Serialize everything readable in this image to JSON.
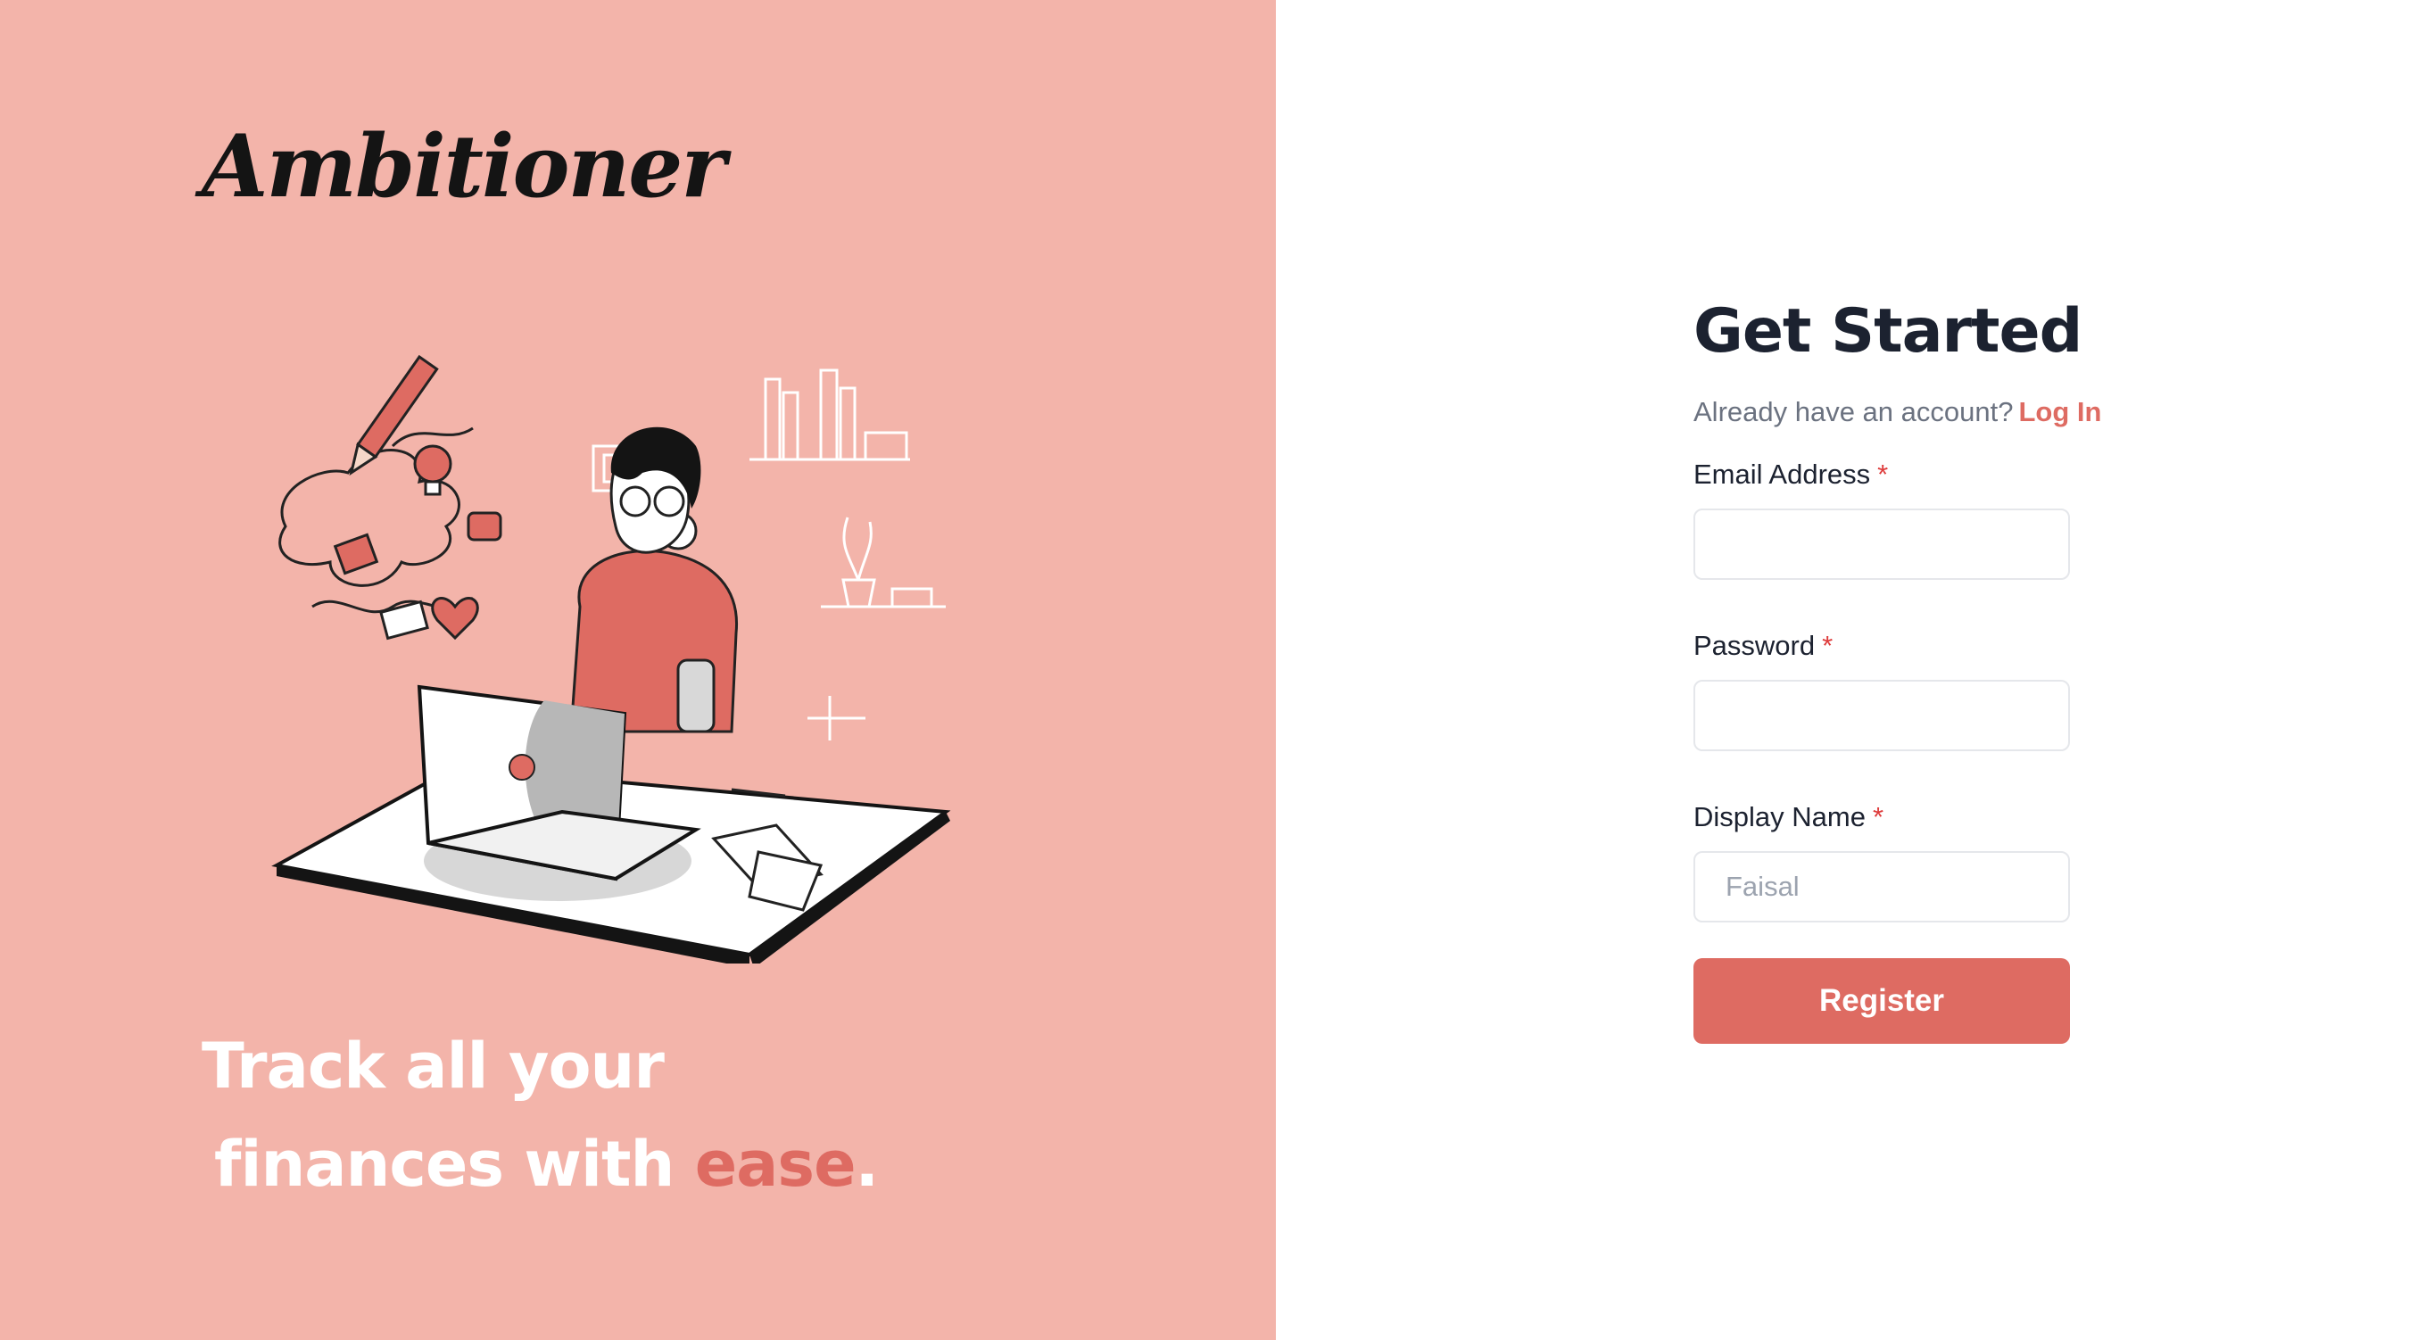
{
  "brand": {
    "name": "Ambitioner"
  },
  "colors": {
    "panel_bg": "#f3b4aa",
    "accent": "#de6b62",
    "heading": "#1c2230",
    "muted": "#6b7280",
    "required": "#de3b3b"
  },
  "hero": {
    "line1": "Track all your",
    "line2_prefix": "finances with ",
    "line2_accent": "ease",
    "line2_suffix": "."
  },
  "form": {
    "title": "Get Started",
    "login_prompt": "Already have an account?",
    "login_link": "Log In",
    "email": {
      "label": "Email Address",
      "required_mark": "*",
      "value": "",
      "placeholder": ""
    },
    "password": {
      "label": "Password",
      "required_mark": "*",
      "value": "",
      "placeholder": ""
    },
    "display_name": {
      "label": "Display Name",
      "required_mark": "*",
      "value": "",
      "placeholder": "Faisal"
    },
    "submit_label": "Register"
  },
  "icons": {
    "illustration": "person-at-laptop-illustration",
    "laptop_logo": "laptop-logo-icon"
  }
}
